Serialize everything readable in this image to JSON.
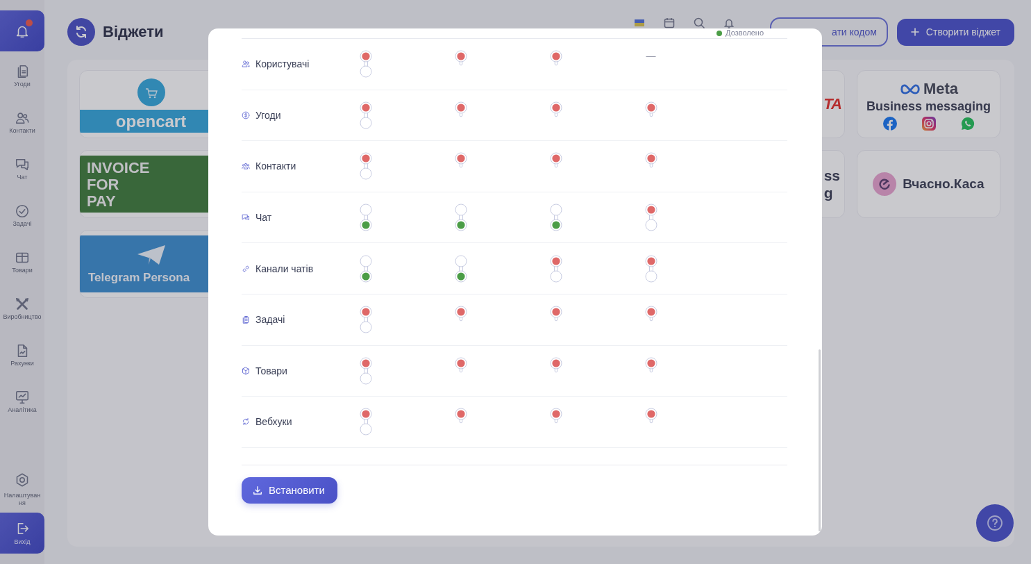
{
  "sidebar": {
    "has_notifications": true,
    "items": [
      {
        "label": "Угоди",
        "selected": false
      },
      {
        "label": "Контакти",
        "selected": false
      },
      {
        "label": "Чат",
        "selected": false
      },
      {
        "label": "Задачі",
        "selected": false
      },
      {
        "label": "Товари",
        "selected": false
      },
      {
        "label": "Виробництво",
        "selected": false
      },
      {
        "label": "Рахунки",
        "selected": false
      },
      {
        "label": "Аналітика",
        "selected": false
      }
    ],
    "settings": {
      "label": "Налаштування"
    },
    "logout": {
      "label": "Вихід"
    }
  },
  "header": {
    "title": "Віджети",
    "code_button": "ати кодом",
    "create_button": "Створити віджет"
  },
  "widgets_left_of_dialog": [
    {
      "kind": "opencart",
      "text": "opencart"
    },
    {
      "kind": "invoice",
      "lines": [
        "INVOICE",
        "FOR",
        "PAY"
      ]
    },
    {
      "kind": "telegram",
      "text": "Telegram Persona"
    }
  ],
  "widgets_cut_by_dialog": [
    {
      "kind": "logo_fragment",
      "text": "TA"
    },
    {
      "kind": "fragment",
      "lines": [
        "ss",
        "g"
      ]
    }
  ],
  "widgets_right_of_dialog": [
    {
      "kind": "meta",
      "brand": "Meta",
      "title": "Business messaging"
    },
    {
      "kind": "vchasno",
      "title": "Вчасно.Каса"
    }
  ],
  "dialog": {
    "legend": "Дозволено",
    "rows": [
      {
        "label": "Користувачі",
        "cells": [
          {
            "kind": "switch",
            "allowed": false
          },
          {
            "kind": "pin",
            "allowed": false
          },
          {
            "kind": "pin",
            "allowed": false
          },
          {
            "kind": "text",
            "text": "—"
          }
        ]
      },
      {
        "label": "Угоди",
        "cells": [
          {
            "kind": "switch",
            "allowed": false
          },
          {
            "kind": "pin",
            "allowed": false
          },
          {
            "kind": "pin",
            "allowed": false
          },
          {
            "kind": "pin",
            "allowed": false
          }
        ]
      },
      {
        "label": "Контакти",
        "cells": [
          {
            "kind": "switch",
            "allowed": false
          },
          {
            "kind": "pin",
            "allowed": false
          },
          {
            "kind": "pin",
            "allowed": false
          },
          {
            "kind": "pin",
            "allowed": false
          }
        ]
      },
      {
        "label": "Чат",
        "cells": [
          {
            "kind": "switch",
            "allowed": true
          },
          {
            "kind": "switch",
            "allowed": true
          },
          {
            "kind": "switch",
            "allowed": true
          },
          {
            "kind": "switch",
            "allowed": false
          }
        ]
      },
      {
        "label": "Канали чатів",
        "cells": [
          {
            "kind": "switch",
            "allowed": true
          },
          {
            "kind": "switch",
            "allowed": true
          },
          {
            "kind": "switch",
            "allowed": false
          },
          {
            "kind": "switch",
            "allowed": false
          }
        ]
      },
      {
        "label": "Задачі",
        "cells": [
          {
            "kind": "switch",
            "allowed": false
          },
          {
            "kind": "pin",
            "allowed": false
          },
          {
            "kind": "pin",
            "allowed": false
          },
          {
            "kind": "pin",
            "allowed": false
          }
        ]
      },
      {
        "label": "Товари",
        "cells": [
          {
            "kind": "switch",
            "allowed": false
          },
          {
            "kind": "pin",
            "allowed": false
          },
          {
            "kind": "pin",
            "allowed": false
          },
          {
            "kind": "pin",
            "allowed": false
          }
        ]
      },
      {
        "label": "Вебхуки",
        "cells": [
          {
            "kind": "switch",
            "allowed": false
          },
          {
            "kind": "pin",
            "allowed": false
          },
          {
            "kind": "pin",
            "allowed": false
          },
          {
            "kind": "pin",
            "allowed": false
          }
        ]
      }
    ],
    "install_button": "Встановити"
  }
}
